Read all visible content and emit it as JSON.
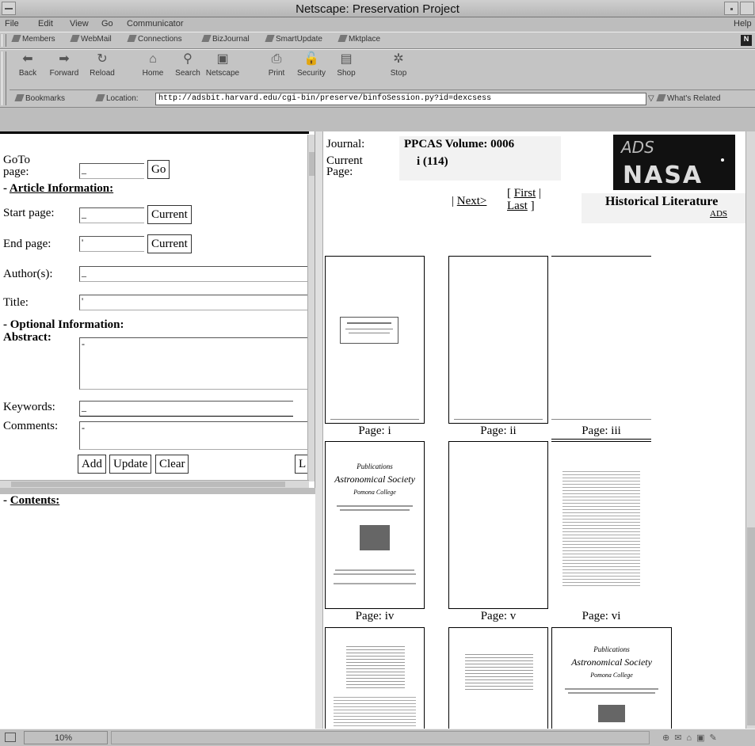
{
  "window": {
    "title": "Netscape: Preservation Project"
  },
  "menu": {
    "file": "File",
    "edit": "Edit",
    "view": "View",
    "go": "Go",
    "communicator": "Communicator",
    "help": "Help"
  },
  "personal_toolbar": [
    "Members",
    "WebMail",
    "Connections",
    "BizJournal",
    "SmartUpdate",
    "Mktplace"
  ],
  "nav_toolbar": [
    {
      "label": "Back",
      "icon": "back-arrow-icon"
    },
    {
      "label": "Forward",
      "icon": "forward-arrow-icon"
    },
    {
      "label": "Reload",
      "icon": "reload-icon"
    },
    {
      "label": "Home",
      "icon": "home-icon"
    },
    {
      "label": "Search",
      "icon": "search-icon"
    },
    {
      "label": "Netscape",
      "icon": "netscape-icon"
    },
    {
      "label": "Print",
      "icon": "print-icon"
    },
    {
      "label": "Security",
      "icon": "lock-icon"
    },
    {
      "label": "Shop",
      "icon": "shop-icon"
    },
    {
      "label": "Stop",
      "icon": "stop-icon"
    }
  ],
  "location_bar": {
    "bookmarks_label": "Bookmarks",
    "location_label": "Location:",
    "url": "http://adsbit.harvard.edu/cgi-bin/preserve/binfoSession.py?id=dexcsess",
    "whats_related": "What's Related"
  },
  "form": {
    "goto_label_line1": "GoTo",
    "goto_label_line2": "page:",
    "goto_value": "_",
    "go_button": "Go",
    "article_section_prefix": "- ",
    "article_section": "Article Information:",
    "start_page_label": "Start page:",
    "start_page_value": "_",
    "current_button": "Current",
    "end_page_label": "End page:",
    "end_page_value": "'",
    "author_label": "Author(s):",
    "author_value": "_",
    "title_label": "Title:",
    "title_value": "'",
    "optional_section": "- Optional Information:",
    "abstract_label": "Abstract:",
    "abstract_value": "-",
    "keywords_label": "Keywords:",
    "keywords_value": "_",
    "comments_label": "Comments:",
    "comments_value": "-",
    "add_button": "Add",
    "update_button": "Update",
    "clear_button": "Clear",
    "l_button": "L"
  },
  "contents": {
    "prefix": "- ",
    "label": "Contents:"
  },
  "header": {
    "journal_label": "Journal:",
    "journal_value": "PPCAS Volume:  0006",
    "current_page_label_line1": "Current",
    "current_page_label_line2": "Page:",
    "current_page_value": "i (114)",
    "next_link": "Next>",
    "first_link": "First",
    "last_link": "Last",
    "logo_text": "ADS",
    "logo_subtext": "NASA",
    "historical_literature": "Historical Literature",
    "ads_link": "ADS"
  },
  "pages": [
    {
      "label": "Page: i"
    },
    {
      "label": "Page: ii"
    },
    {
      "label": "Page: iii"
    },
    {
      "label": "Page: iv"
    },
    {
      "label": "Page: v"
    },
    {
      "label": "Page: vi"
    },
    {
      "label": ""
    },
    {
      "label": ""
    },
    {
      "label": ""
    }
  ],
  "status_bar": {
    "progress": "10%"
  }
}
